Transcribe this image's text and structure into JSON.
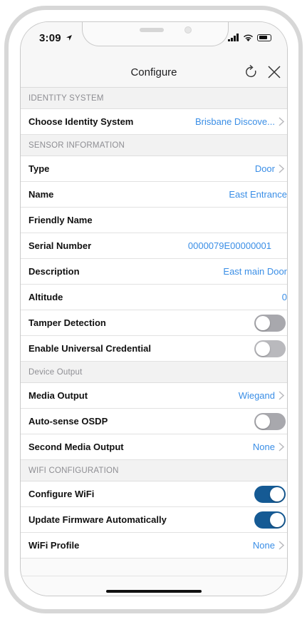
{
  "status_bar": {
    "time": "3:09"
  },
  "nav": {
    "title": "Configure"
  },
  "sections": {
    "identity": {
      "header": "IDENTITY SYSTEM",
      "choose": {
        "label": "Choose Identity System",
        "value": "Brisbane Discove..."
      }
    },
    "sensor": {
      "header": "SENSOR INFORMATION",
      "type": {
        "label": "Type",
        "value": "Door"
      },
      "name": {
        "label": "Name",
        "value": "East Entrance"
      },
      "friendly_name": {
        "label": "Friendly Name",
        "value": ""
      },
      "serial": {
        "label": "Serial Number",
        "value": "0000079E00000001"
      },
      "description": {
        "label": "Description",
        "value": "East main Door"
      },
      "altitude": {
        "label": "Altitude",
        "value": "0"
      },
      "tamper": {
        "label": "Tamper Detection",
        "on": false
      },
      "universal_credential": {
        "label": "Enable Universal Credential",
        "on": false
      }
    },
    "device_output": {
      "header": "Device Output",
      "media_output": {
        "label": "Media Output",
        "value": "Wiegand"
      },
      "osdp": {
        "label": "Auto-sense OSDP",
        "on": false
      },
      "second_media": {
        "label": "Second Media Output",
        "value": "None"
      }
    },
    "wifi": {
      "header": "WIFI CONFIGURATION",
      "configure": {
        "label": "Configure WiFi",
        "on": true
      },
      "firmware": {
        "label": "Update Firmware Automatically",
        "on": true
      },
      "profile": {
        "label": "WiFi Profile",
        "value": "None"
      }
    }
  },
  "colors": {
    "accent": "#3a8ee6",
    "toggle_on": "#155a94",
    "toggle_off": "#a8a8ad"
  },
  "icons": {
    "refresh": "refresh-icon",
    "close": "close-icon",
    "chevron": "chevron-right-icon"
  }
}
